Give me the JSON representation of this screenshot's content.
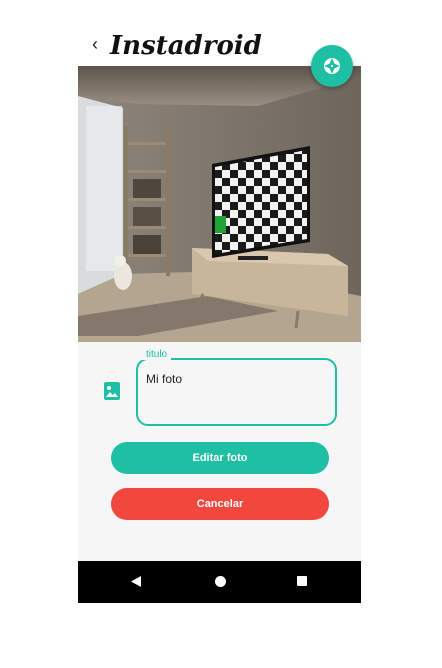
{
  "header": {
    "back_glyph": "‹",
    "title": "Instadroid"
  },
  "icons": {
    "fab": "camera-shutter-icon",
    "image": "image-icon",
    "nav": [
      "triangle-back-icon",
      "circle-home-icon",
      "square-recents-icon"
    ]
  },
  "form": {
    "title_label": "titulo",
    "title_value": "Mi foto",
    "edit_button": "Editar foto",
    "cancel_button": "Cancelar"
  },
  "colors": {
    "accent": "#1fbfa4",
    "danger": "#f2473c",
    "navbar": "#000000"
  }
}
